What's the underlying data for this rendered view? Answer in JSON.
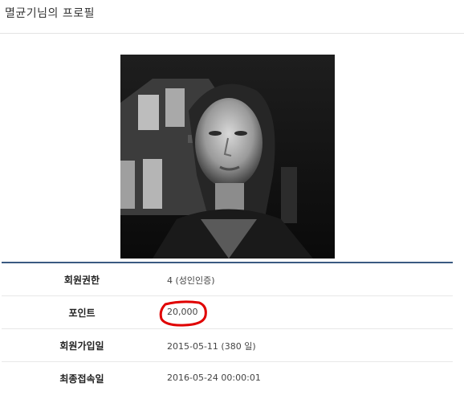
{
  "header": {
    "title": "멸균기님의 프로필"
  },
  "profile": {
    "rows": [
      {
        "label": "회원권한",
        "value": "4 (성인인증)"
      },
      {
        "label": "포인트",
        "value": "20,000"
      },
      {
        "label": "회원가입일",
        "value": "2015-05-11 (380 일)"
      },
      {
        "label": "최종접속일",
        "value": "2016-05-24 00:00:01"
      }
    ]
  },
  "colors": {
    "table_rule": "#3a5a82",
    "annotation": "#e00000"
  }
}
